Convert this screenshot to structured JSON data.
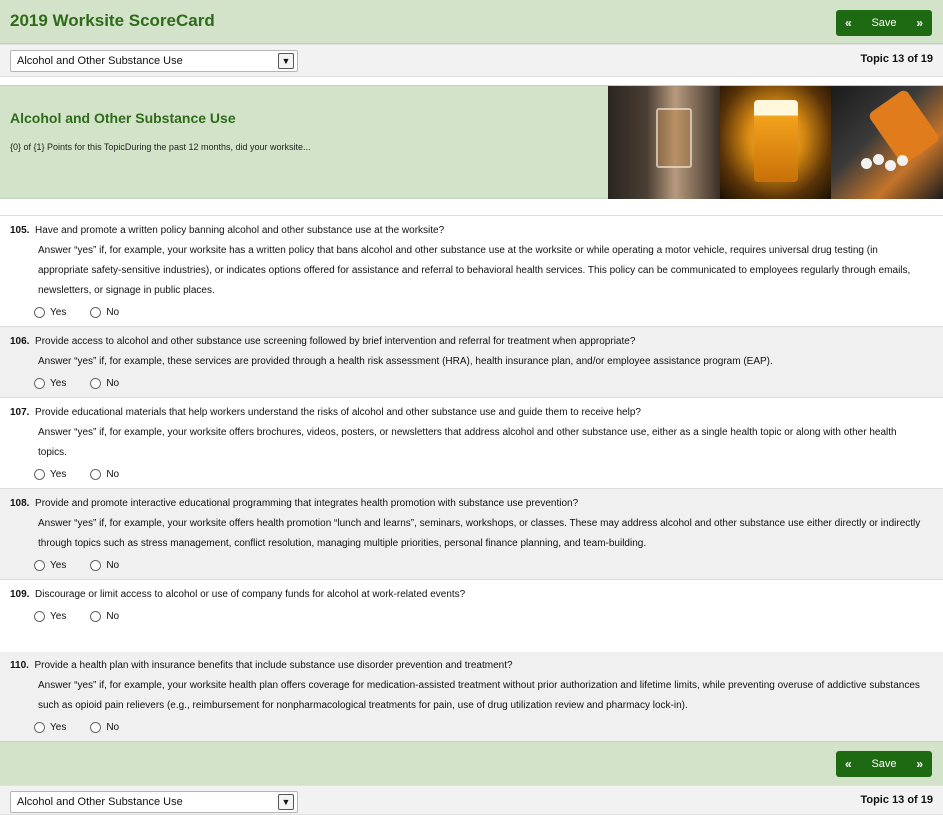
{
  "app": {
    "title": "2019 Worksite ScoreCard"
  },
  "nav": {
    "save_label": "Save",
    "prev_icon": "«",
    "next_icon": "»"
  },
  "topic_select": {
    "value": "Alcohol and Other Substance Use",
    "arrow_icon": "chevron-down-icon",
    "arrow_glyph": "▼"
  },
  "topic_count": "Topic 13 of 19",
  "topic": {
    "heading": "Alcohol and Other Substance Use",
    "points_text": "{0} of {1} Points for this TopicDuring the past 12 months, did your worksite..."
  },
  "options": {
    "yes": "Yes",
    "no": "No"
  },
  "questions": [
    {
      "number": "105.",
      "text": "Have and promote a written policy banning alcohol and other substance use at the worksite?",
      "help": "Answer “yes” if, for example, your worksite has a written policy that bans alcohol and other substance use at the worksite or while operating a motor vehicle, requires universal drug testing (in appropriate safety-sensitive industries), or indicates options offered for assistance and referral to behavioral health services. This policy can be communicated to employees regularly through emails, newsletters, or signage in public places."
    },
    {
      "number": "106.",
      "text": "Provide access to alcohol and other substance use screening followed by brief intervention and referral for treatment when appropriate?",
      "help": "Answer “yes” if, for example, these services are provided through a health risk assessment (HRA), health insurance plan, and/or employee assistance program (EAP)."
    },
    {
      "number": "107.",
      "text": "Provide educational materials that help workers understand the risks of alcohol and other substance use and guide them to receive help?",
      "help": "Answer “yes” if, for example, your worksite offers brochures, videos, posters, or newsletters that address alcohol and other substance use, either as a single health topic or along with other health topics."
    },
    {
      "number": "108.",
      "text": "Provide and promote interactive educational programming that integrates health promotion with substance use prevention?",
      "help": "Answer “yes” if, for example, your worksite offers health promotion “lunch and learns”, seminars, workshops, or classes. These may address alcohol and other substance use either directly or indirectly through topics such as stress management, conflict resolution, managing multiple priorities, personal finance planning, and team-building."
    },
    {
      "number": "109.",
      "text": "Discourage or limit access to alcohol or use of company funds for alcohol at work-related events?",
      "help": ""
    },
    {
      "number": "110.",
      "text": "Provide a health plan with insurance benefits that include substance use disorder prevention and treatment?",
      "help": "Answer “yes” if, for example, your worksite health plan offers coverage for medication-assisted treatment without prior authorization and lifetime limits, while preventing overuse of addictive substances such as opioid pain relievers (e.g., reimbursement for nonpharmacological treatments for pain, use of drug utilization review and pharmacy lock-in)."
    }
  ]
}
